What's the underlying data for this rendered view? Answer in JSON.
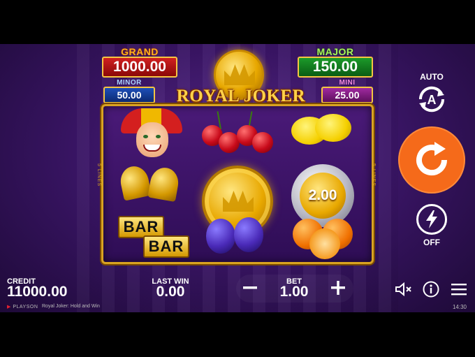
{
  "jackpots": {
    "grand": {
      "label": "GRAND",
      "value": "1000.00"
    },
    "major": {
      "label": "MAJOR",
      "value": "150.00"
    },
    "minor": {
      "label": "MINOR",
      "value": "50.00"
    },
    "mini": {
      "label": "MINI",
      "value": "25.00"
    }
  },
  "logo": {
    "text": "ROYAL JOKER"
  },
  "reels": {
    "lines_label": "5 LINES",
    "columns": [
      [
        "joker",
        "bells",
        "bar-bar"
      ],
      [
        "cherries",
        "gold-crown-coin",
        "plums"
      ],
      [
        "lemons",
        "silver-coin",
        "oranges"
      ]
    ],
    "coin_value": "2.00"
  },
  "controls": {
    "auto_label": "AUTO",
    "auto_icon": "autoplay-a-icon",
    "spin_icon": "spin-arrow-icon",
    "turbo_icon": "lightning-icon",
    "turbo_label": "OFF"
  },
  "bottom_bar": {
    "credit_label": "CREDIT",
    "credit_value": "11000.00",
    "last_win_label": "LAST WIN",
    "last_win_value": "0.00",
    "bet_label": "BET",
    "bet_value": "1.00",
    "minus_icon": "minus-icon",
    "plus_icon": "plus-icon",
    "sound_icon": "sound-muted-icon",
    "info_icon": "info-icon",
    "menu_icon": "hamburger-menu-icon"
  },
  "footer": {
    "brand": "PLAYSON",
    "game_name": "Royal Joker: Hold and Win",
    "time": "14:30"
  },
  "colors": {
    "spin_button": "#f56a1a",
    "frame_gold": "#d9a321",
    "background_purple": "#3a1566"
  }
}
